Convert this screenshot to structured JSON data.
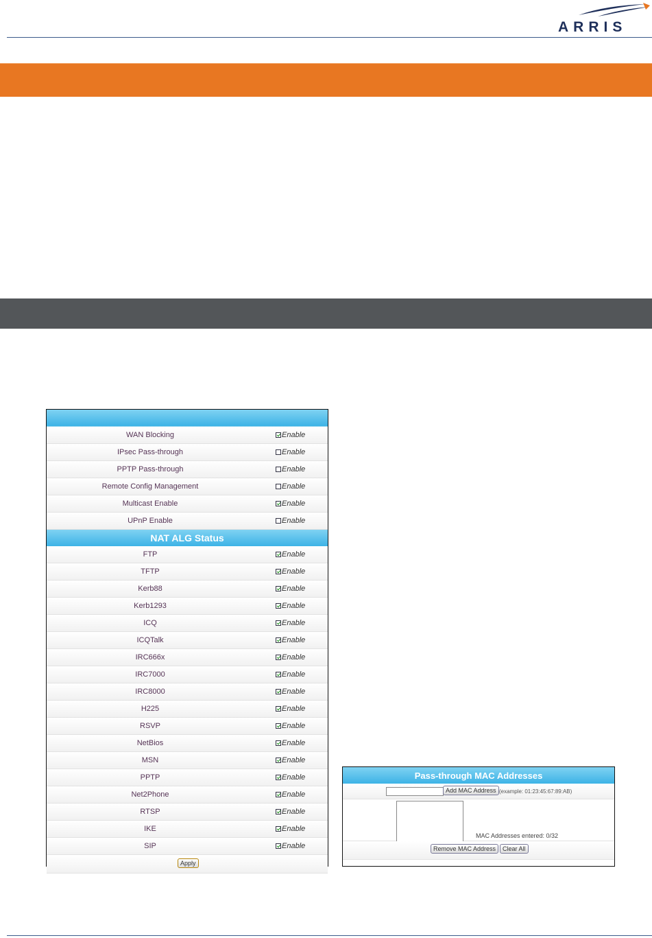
{
  "brand": {
    "logo_text": "ARRIS"
  },
  "colors": {
    "orange": "#e87722",
    "gray": "#535659",
    "table_header": "#3db3e6"
  },
  "options": {
    "rows": [
      {
        "label": "WAN Blocking",
        "checked": true,
        "check_label": "Enable"
      },
      {
        "label": "IPsec Pass-through",
        "checked": false,
        "check_label": "Enable"
      },
      {
        "label": "PPTP Pass-through",
        "checked": false,
        "check_label": "Enable"
      },
      {
        "label": "Remote Config Management",
        "checked": false,
        "check_label": "Enable"
      },
      {
        "label": "Multicast Enable",
        "checked": true,
        "check_label": "Enable"
      },
      {
        "label": "UPnP Enable",
        "checked": false,
        "check_label": "Enable"
      }
    ]
  },
  "nat_alg": {
    "title": "NAT ALG Status",
    "rows": [
      {
        "label": "FTP",
        "checked": true,
        "check_label": "Enable"
      },
      {
        "label": "TFTP",
        "checked": true,
        "check_label": "Enable"
      },
      {
        "label": "Kerb88",
        "checked": true,
        "check_label": "Enable"
      },
      {
        "label": "Kerb1293",
        "checked": true,
        "check_label": "Enable"
      },
      {
        "label": "ICQ",
        "checked": true,
        "check_label": "Enable"
      },
      {
        "label": "ICQTalk",
        "checked": true,
        "check_label": "Enable"
      },
      {
        "label": "IRC666x",
        "checked": true,
        "check_label": "Enable"
      },
      {
        "label": "IRC7000",
        "checked": true,
        "check_label": "Enable"
      },
      {
        "label": "IRC8000",
        "checked": true,
        "check_label": "Enable"
      },
      {
        "label": "H225",
        "checked": true,
        "check_label": "Enable"
      },
      {
        "label": "RSVP",
        "checked": true,
        "check_label": "Enable"
      },
      {
        "label": "NetBios",
        "checked": true,
        "check_label": "Enable"
      },
      {
        "label": "MSN",
        "checked": true,
        "check_label": "Enable"
      },
      {
        "label": "PPTP",
        "checked": true,
        "check_label": "Enable"
      },
      {
        "label": "Net2Phone",
        "checked": true,
        "check_label": "Enable"
      },
      {
        "label": "RTSP",
        "checked": true,
        "check_label": "Enable"
      },
      {
        "label": "IKE",
        "checked": true,
        "check_label": "Enable"
      },
      {
        "label": "SIP",
        "checked": true,
        "check_label": "Enable"
      }
    ],
    "apply_label": "Apply"
  },
  "passthrough": {
    "title": "Pass-through MAC Addresses",
    "input_value": "",
    "add_label": "Add MAC Address",
    "example_text": "(example: 01:23:45:67:89:AB)",
    "count_text": "MAC Addresses entered: 0/32",
    "remove_label": "Remove MAC Address",
    "clear_label": "Clear All"
  }
}
